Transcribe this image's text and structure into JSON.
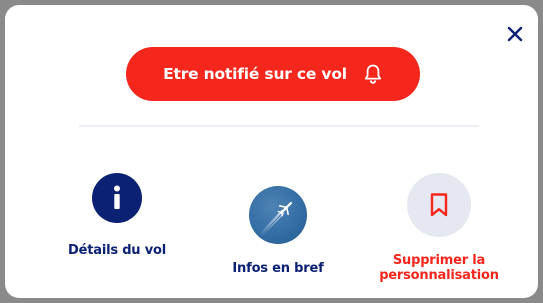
{
  "modal": {
    "close_icon": "close-icon",
    "notify_button": {
      "label": "Etre notifié sur ce vol",
      "icon": "bell-icon",
      "color": "#f5271d"
    },
    "actions": [
      {
        "label": "Détails du vol",
        "icon": "info-icon",
        "color": "#0b2174"
      },
      {
        "label": "Infos en bref",
        "icon": "airplane-photo",
        "color": "#0b2174"
      },
      {
        "label_line1": "Supprimer la",
        "label_line2": "personnalisation",
        "icon": "bookmark-icon",
        "color": "#f5271d"
      }
    ]
  }
}
